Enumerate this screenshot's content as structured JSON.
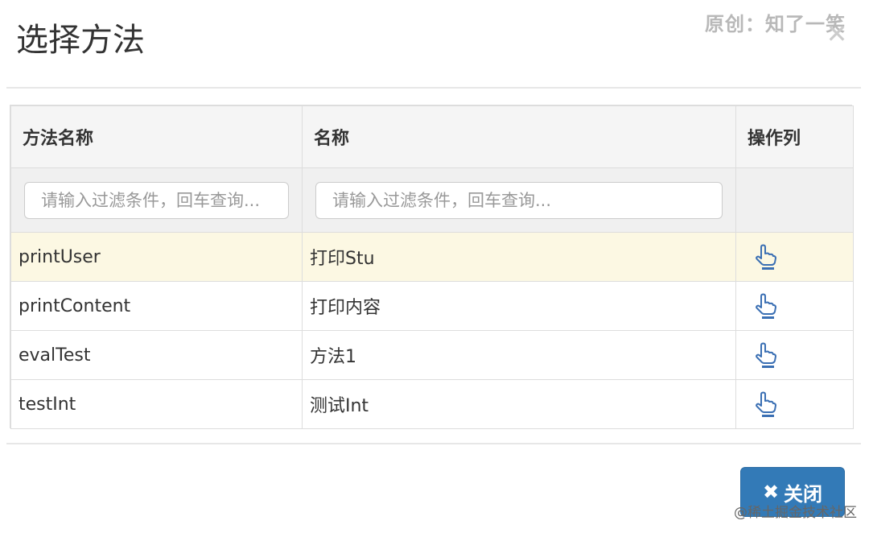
{
  "modal": {
    "title": "选择方法",
    "close_glyph": "✕",
    "watermark_top": "原创：知了一笑",
    "watermark_bottom": "@稀土掘金技术社区"
  },
  "table": {
    "headers": [
      "方法名称",
      "名称",
      "操作列"
    ],
    "filters": {
      "method_name_placeholder": "请输入过滤条件，回车查询...",
      "name_placeholder": "请输入过滤条件，回车查询..."
    },
    "rows": [
      {
        "method": "printUser",
        "name": "打印Stu",
        "action_icon": "pointer-hand-icon"
      },
      {
        "method": "printContent",
        "name": "打印内容",
        "action_icon": "pointer-hand-icon"
      },
      {
        "method": "evalTest",
        "name": "方法1",
        "action_icon": "pointer-hand-icon"
      },
      {
        "method": "testInt",
        "name": "测试Int",
        "action_icon": "pointer-hand-icon"
      }
    ],
    "highlight_color": "#fcf8e3"
  },
  "footer": {
    "close_button_label": "关闭",
    "close_button_glyph": "✖",
    "button_color": "#337ab7"
  },
  "colors": {
    "icon": "#3a6fb3"
  }
}
